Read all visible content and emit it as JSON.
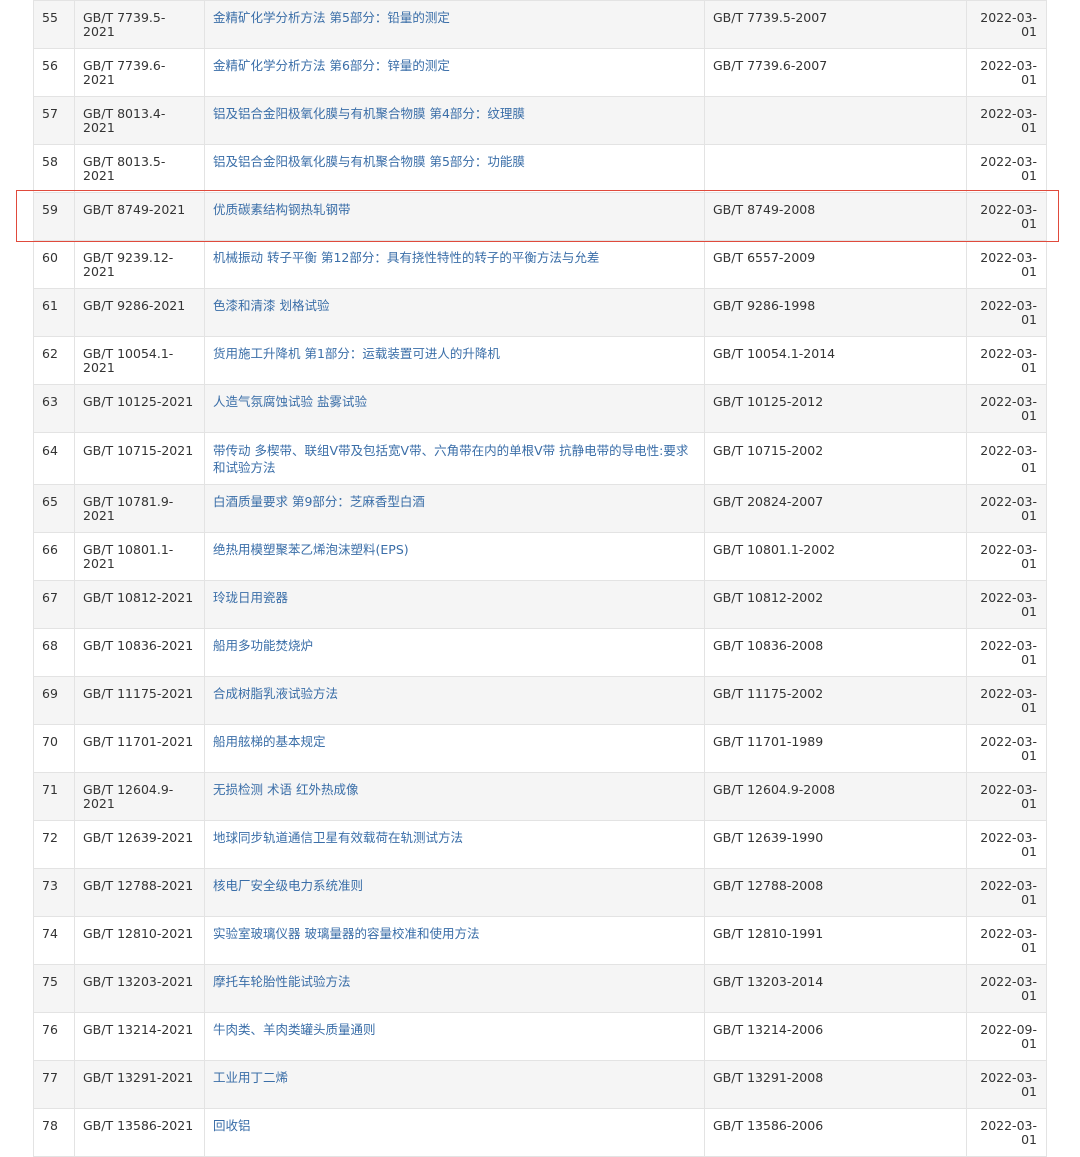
{
  "table": {
    "rows": [
      {
        "no": "55",
        "code": "GB/T 7739.5-2021",
        "name": "金精矿化学分析方法 第5部分：铅量的测定",
        "replaced": "GB/T 7739.5-2007",
        "date": "2022-03-01"
      },
      {
        "no": "56",
        "code": "GB/T 7739.6-2021",
        "name": "金精矿化学分析方法 第6部分：锌量的测定",
        "replaced": "GB/T 7739.6-2007",
        "date": "2022-03-01"
      },
      {
        "no": "57",
        "code": "GB/T 8013.4-2021",
        "name": "铝及铝合金阳极氧化膜与有机聚合物膜 第4部分：纹理膜",
        "replaced": "",
        "date": "2022-03-01"
      },
      {
        "no": "58",
        "code": "GB/T 8013.5-2021",
        "name": "铝及铝合金阳极氧化膜与有机聚合物膜 第5部分：功能膜",
        "replaced": "",
        "date": "2022-03-01"
      },
      {
        "no": "59",
        "code": "GB/T 8749-2021",
        "name": "优质碳素结构钢热轧钢带",
        "replaced": "GB/T 8749-2008",
        "date": "2022-03-01"
      },
      {
        "no": "60",
        "code": "GB/T 9239.12-2021",
        "name": "机械振动 转子平衡 第12部分：具有挠性特性的转子的平衡方法与允差",
        "replaced": "GB/T 6557-2009",
        "date": "2022-03-01"
      },
      {
        "no": "61",
        "code": "GB/T 9286-2021",
        "name": "色漆和清漆 划格试验",
        "replaced": "GB/T 9286-1998",
        "date": "2022-03-01"
      },
      {
        "no": "62",
        "code": "GB/T 10054.1-2021",
        "name": "货用施工升降机 第1部分：运载装置可进人的升降机",
        "replaced": "GB/T 10054.1-2014",
        "date": "2022-03-01"
      },
      {
        "no": "63",
        "code": "GB/T 10125-2021",
        "name": "人造气氛腐蚀试验 盐雾试验",
        "replaced": "GB/T 10125-2012",
        "date": "2022-03-01"
      },
      {
        "no": "64",
        "code": "GB/T 10715-2021",
        "name": "带传动 多楔带、联组V带及包括宽V带、六角带在内的单根V带 抗静电带的导电性:要求和试验方法",
        "replaced": "GB/T 10715-2002",
        "date": "2022-03-01"
      },
      {
        "no": "65",
        "code": "GB/T 10781.9-2021",
        "name": "白酒质量要求 第9部分：芝麻香型白酒",
        "replaced": "GB/T 20824-2007",
        "date": "2022-03-01"
      },
      {
        "no": "66",
        "code": "GB/T 10801.1-2021",
        "name": "绝热用模塑聚苯乙烯泡沫塑料(EPS)",
        "replaced": "GB/T 10801.1-2002",
        "date": "2022-03-01"
      },
      {
        "no": "67",
        "code": "GB/T 10812-2021",
        "name": "玲珑日用瓷器",
        "replaced": "GB/T 10812-2002",
        "date": "2022-03-01"
      },
      {
        "no": "68",
        "code": "GB/T 10836-2021",
        "name": "船用多功能焚烧炉",
        "replaced": "GB/T 10836-2008",
        "date": "2022-03-01"
      },
      {
        "no": "69",
        "code": "GB/T 11175-2021",
        "name": "合成树脂乳液试验方法",
        "replaced": "GB/T 11175-2002",
        "date": "2022-03-01"
      },
      {
        "no": "70",
        "code": "GB/T 11701-2021",
        "name": "船用舷梯的基本规定",
        "replaced": "GB/T 11701-1989",
        "date": "2022-03-01"
      },
      {
        "no": "71",
        "code": "GB/T 12604.9-2021",
        "name": "无损检测 术语 红外热成像",
        "replaced": "GB/T 12604.9-2008",
        "date": "2022-03-01"
      },
      {
        "no": "72",
        "code": "GB/T 12639-2021",
        "name": "地球同步轨道通信卫星有效载荷在轨测试方法",
        "replaced": "GB/T 12639-1990",
        "date": "2022-03-01"
      },
      {
        "no": "73",
        "code": "GB/T 12788-2021",
        "name": "核电厂安全级电力系统准则",
        "replaced": "GB/T 12788-2008",
        "date": "2022-03-01"
      },
      {
        "no": "74",
        "code": "GB/T 12810-2021",
        "name": "实验室玻璃仪器 玻璃量器的容量校准和使用方法",
        "replaced": "GB/T 12810-1991",
        "date": "2022-03-01"
      },
      {
        "no": "75",
        "code": "GB/T 13203-2021",
        "name": "摩托车轮胎性能试验方法",
        "replaced": "GB/T 13203-2014",
        "date": "2022-03-01"
      },
      {
        "no": "76",
        "code": "GB/T 13214-2021",
        "name": "牛肉类、羊肉类罐头质量通则",
        "replaced": "GB/T 13214-2006",
        "date": "2022-09-01"
      },
      {
        "no": "77",
        "code": "GB/T 13291-2021",
        "name": "工业用丁二烯",
        "replaced": "GB/T 13291-2008",
        "date": "2022-03-01"
      },
      {
        "no": "78",
        "code": "GB/T 13586-2021",
        "name": "回收铝",
        "replaced": "GB/T 13586-2006",
        "date": "2022-03-01"
      }
    ]
  },
  "colors": {
    "link": "#3a6ea8",
    "highlight_border": "#e04a3c",
    "stripe": "#f5f5f5",
    "border": "#e3e3e3"
  }
}
